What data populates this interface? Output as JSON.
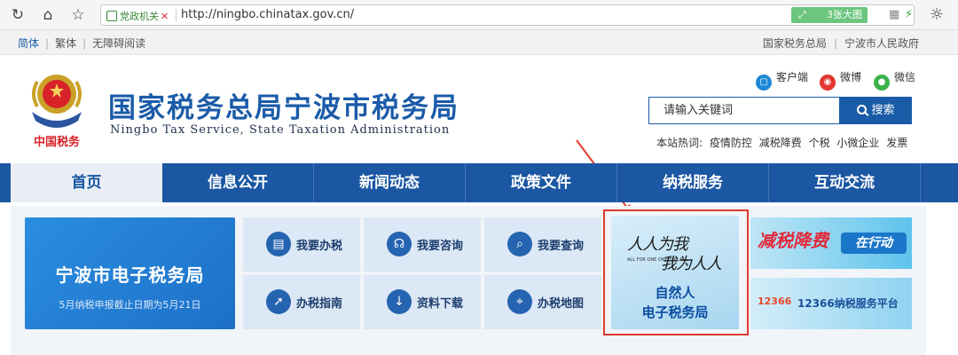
{
  "browser": {
    "secure_label": "党政机关",
    "url": "http://ningbo.chinatax.gov.cn/",
    "image_button": "3张大图"
  },
  "util": {
    "lang_simplified": "简体",
    "lang_traditional": "繁体",
    "accessible": "无障碍阅读",
    "link_sat": "国家税务总局",
    "link_gov": "宁波市人民政府"
  },
  "header": {
    "title": "国家税务总局宁波市税务局",
    "subtitle": "Ningbo Tax Service, State Taxation Administration",
    "emblem_text": "中国税务",
    "social": {
      "client": "客户端",
      "weibo": "微博",
      "wechat": "微信"
    },
    "search": {
      "placeholder": "请输入关键词",
      "button": "搜索"
    },
    "hot_label": "本站热词:",
    "hot_words": [
      "疫情防控",
      "减税降费",
      "个税",
      "小微企业",
      "发票"
    ]
  },
  "nav": [
    "首页",
    "信息公开",
    "新闻动态",
    "政策文件",
    "纳税服务",
    "互动交流"
  ],
  "banner": {
    "title": "宁波市电子税务局",
    "subtitle": "5月纳税申报截止日期为5月21日"
  },
  "tiles": [
    {
      "label": "我要办税",
      "icon": "tax-handle-icon"
    },
    {
      "label": "我要咨询",
      "icon": "headset-icon"
    },
    {
      "label": "我要查询",
      "icon": "search-doc-icon"
    },
    {
      "label": "办税指南",
      "icon": "compass-icon"
    },
    {
      "label": "资料下载",
      "icon": "download-icon"
    },
    {
      "label": "办税地图",
      "icon": "map-pin-icon"
    }
  ],
  "np_card": {
    "calligraphy_line1": "人人为我",
    "calligraphy_line2": "我为人人",
    "tiny_text": "ALL FOR ONE  ONE FOR ALL",
    "line1": "自然人",
    "line2": "电子税务局"
  },
  "promo": {
    "jsf_left": "减税降费",
    "jsf_right": "在行动",
    "hotline_logo": "12366",
    "hotline_text": "12366纳税服务平台"
  },
  "colors": {
    "brand": "#1b57a2",
    "highlight": "#e03a2e"
  }
}
